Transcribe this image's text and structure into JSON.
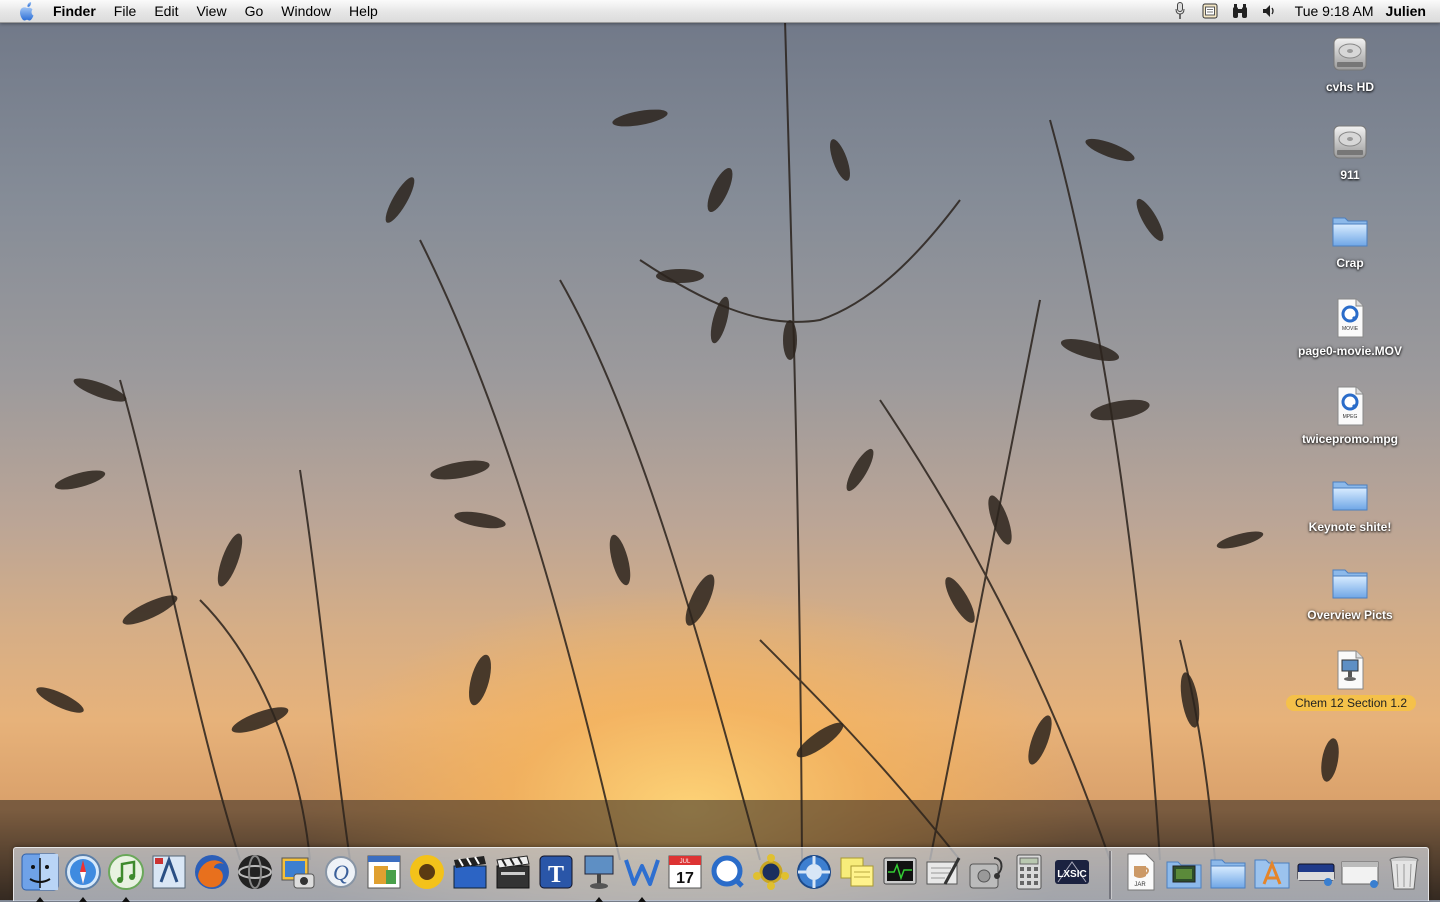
{
  "menubar": {
    "app_name": "Finder",
    "menus": [
      "File",
      "Edit",
      "View",
      "Go",
      "Window",
      "Help"
    ],
    "clock": "Tue 9:18 AM",
    "user": "Julien",
    "extras": [
      "microphone-icon",
      "script-menu-icon",
      "binoculars-icon",
      "volume-icon"
    ]
  },
  "desktop": {
    "items": [
      {
        "label": "cvhs HD",
        "kind": "hard-drive"
      },
      {
        "label": "911",
        "kind": "hard-drive"
      },
      {
        "label": "Crap",
        "kind": "folder"
      },
      {
        "label": "page0-movie.MOV",
        "kind": "movie-file",
        "badge": "MOVIE"
      },
      {
        "label": "twicepromo.mpg",
        "kind": "movie-file",
        "badge": "MPEG"
      },
      {
        "label": "Keynote shite!",
        "kind": "folder"
      },
      {
        "label": "Overview Picts",
        "kind": "folder"
      },
      {
        "label": "Chem 12 Section 1.2",
        "kind": "keynote-file",
        "selected": true
      }
    ]
  },
  "dock": {
    "apps": [
      {
        "name": "finder-icon",
        "running": true
      },
      {
        "name": "safari-icon",
        "running": true
      },
      {
        "name": "itunes-icon",
        "running": true
      },
      {
        "name": "mail-icon",
        "running": false
      },
      {
        "name": "firefox-icon",
        "running": false
      },
      {
        "name": "camino-icon",
        "running": false
      },
      {
        "name": "iphoto-icon",
        "running": false
      },
      {
        "name": "quicksilver-icon",
        "running": false
      },
      {
        "name": "preview-icon",
        "running": false
      },
      {
        "name": "sunflower-icon",
        "running": false
      },
      {
        "name": "imovie-icon",
        "running": false
      },
      {
        "name": "final-cut-icon",
        "running": false
      },
      {
        "name": "textedit-icon",
        "running": false
      },
      {
        "name": "keynote-icon",
        "running": true
      },
      {
        "name": "word-icon",
        "running": true
      },
      {
        "name": "ical-icon",
        "running": false,
        "date_month": "JUL",
        "date_day": "17"
      },
      {
        "name": "quicktime-icon",
        "running": false
      },
      {
        "name": "network-icon",
        "running": false
      },
      {
        "name": "system-preferences-icon",
        "running": false
      },
      {
        "name": "stickies-icon",
        "running": false
      },
      {
        "name": "activity-monitor-icon",
        "running": false
      },
      {
        "name": "script-editor-icon",
        "running": false
      },
      {
        "name": "disk-utility-icon",
        "running": false
      },
      {
        "name": "calculator-icon",
        "running": false
      },
      {
        "name": "lexis-icon",
        "running": false,
        "text": "LXSIC"
      }
    ],
    "docs": [
      {
        "name": "jar-document-icon",
        "text": "JAR"
      },
      {
        "name": "screenshot-folder-icon"
      },
      {
        "name": "documents-folder-icon"
      },
      {
        "name": "applications-folder-icon"
      },
      {
        "name": "drive-stack-icon"
      },
      {
        "name": "window-stack-icon"
      },
      {
        "name": "trash-icon"
      }
    ]
  },
  "colors": {
    "selection_label": "#f5c14a",
    "sky_top": "#6f7787",
    "sunset": "#e7b27a"
  }
}
